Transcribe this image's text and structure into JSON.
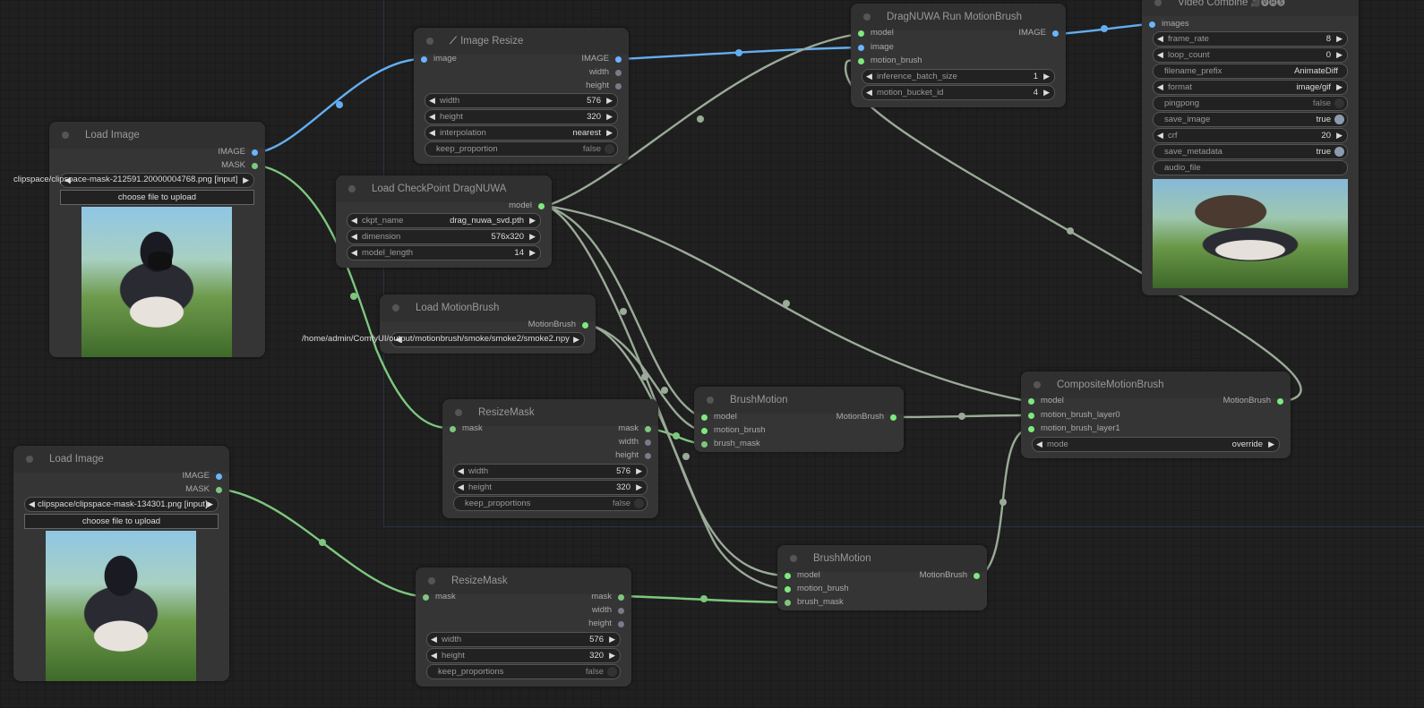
{
  "canvas": {
    "link_color_model": "#9aab98",
    "link_color_image": "#64aef0",
    "link_color_mask": "#7ec77e",
    "group_border_color": "#263246"
  },
  "nodes": {
    "load_image_1": {
      "title": "Load Image",
      "outputs": [
        "IMAGE",
        "MASK"
      ],
      "image_combo": "clipspace/clipspace-mask-212591.20000004768.png [input]",
      "upload_button": "choose file to upload",
      "preview": "girl-with-masked-face"
    },
    "load_image_2": {
      "title": "Load Image",
      "outputs": [
        "IMAGE",
        "MASK"
      ],
      "image_combo": "clipspace/clipspace-mask-134301.png [input]",
      "upload_button": "choose file to upload",
      "preview": "girl-with-mask-region"
    },
    "image_resize": {
      "title": "Image Resize",
      "title_icon": "wrench-icon",
      "inputs": [
        "image"
      ],
      "outputs": [
        "IMAGE",
        "width",
        "height"
      ],
      "widgets": [
        {
          "label": "width",
          "value": "576"
        },
        {
          "label": "height",
          "value": "320"
        },
        {
          "label": "interpolation",
          "value": "nearest"
        },
        {
          "label": "keep_proportion",
          "value": "false"
        }
      ]
    },
    "load_checkpoint": {
      "title": "Load CheckPoint DragNUWA",
      "outputs": [
        "model"
      ],
      "widgets": [
        {
          "label": "ckpt_name",
          "value": "drag_nuwa_svd.pth"
        },
        {
          "label": "dimension",
          "value": "576x320"
        },
        {
          "label": "model_length",
          "value": "14"
        }
      ]
    },
    "load_motionbrush": {
      "title": "Load MotionBrush",
      "outputs": [
        "MotionBrush"
      ],
      "path_combo": "/home/admin/ComfyUI/output/motionbrush/smoke/smoke2/smoke2.npy"
    },
    "resize_mask_1": {
      "title": "ResizeMask",
      "inputs": [
        "mask"
      ],
      "outputs": [
        "mask",
        "width",
        "height"
      ],
      "widgets": [
        {
          "label": "width",
          "value": "576"
        },
        {
          "label": "height",
          "value": "320"
        },
        {
          "label": "keep_proportions",
          "value": "false"
        }
      ]
    },
    "resize_mask_2": {
      "title": "ResizeMask",
      "inputs": [
        "mask"
      ],
      "outputs": [
        "mask",
        "width",
        "height"
      ],
      "widgets": [
        {
          "label": "width",
          "value": "576"
        },
        {
          "label": "height",
          "value": "320"
        },
        {
          "label": "keep_proportions",
          "value": "false"
        }
      ]
    },
    "brush_motion_1": {
      "title": "BrushMotion",
      "inputs": [
        "model",
        "motion_brush",
        "brush_mask"
      ],
      "outputs": [
        "MotionBrush"
      ]
    },
    "brush_motion_2": {
      "title": "BrushMotion",
      "inputs": [
        "model",
        "motion_brush",
        "brush_mask"
      ],
      "outputs": [
        "MotionBrush"
      ]
    },
    "composite": {
      "title": "CompositeMotionBrush",
      "inputs": [
        "model",
        "motion_brush_layer0",
        "motion_brush_layer1"
      ],
      "outputs": [
        "MotionBrush"
      ],
      "widgets": [
        {
          "label": "mode",
          "value": "override"
        }
      ]
    },
    "dragnuwa_run": {
      "title": "DragNUWA Run MotionBrush",
      "inputs": [
        "model",
        "image",
        "motion_brush"
      ],
      "outputs": [
        "IMAGE"
      ],
      "widgets": [
        {
          "label": "inference_batch_size",
          "value": "1"
        },
        {
          "label": "motion_bucket_id",
          "value": "4"
        }
      ]
    },
    "video_combine": {
      "title": "Video Combine",
      "title_badges": "🎥🅥🅗🅢",
      "inputs": [
        "images"
      ],
      "widgets": [
        {
          "label": "frame_rate",
          "value": "8"
        },
        {
          "label": "loop_count",
          "value": "0"
        },
        {
          "label": "filename_prefix",
          "value": "AnimateDiff"
        },
        {
          "label": "format",
          "value": "image/gif"
        },
        {
          "label": "pingpong",
          "value": "false"
        },
        {
          "label": "save_image",
          "value": "true"
        },
        {
          "label": "crf",
          "value": "20"
        },
        {
          "label": "save_metadata",
          "value": "true"
        },
        {
          "label": "audio_file",
          "value": ""
        }
      ],
      "preview": "animated-output-gif"
    }
  }
}
